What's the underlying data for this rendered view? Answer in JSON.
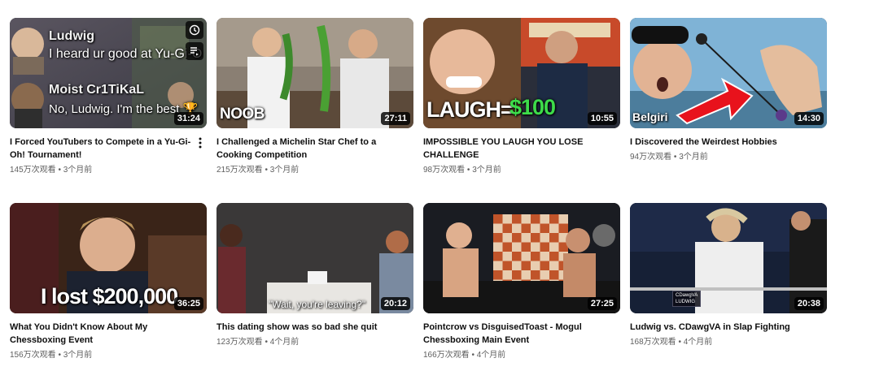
{
  "videos": [
    {
      "title": "I Forced YouTubers to Compete in a Yu-Gi-Oh! Tournament!",
      "views": "145万次观看",
      "age": "3个月前",
      "duration": "31:24",
      "overlay": {
        "name1": "Ludwig",
        "line1": "I heard ur good at Yu-Gi-O",
        "name2": "Moist Cr1TiKaL",
        "line2": "No, Ludwig. I'm the best 🏆"
      },
      "hover_icons": [
        "watch-later-icon",
        "add-to-queue-icon"
      ],
      "show_menu": true
    },
    {
      "title": "I Challenged a Michelin Star Chef to a Cooking Competition",
      "views": "215万次观看",
      "age": "3个月前",
      "duration": "27:11",
      "overlay": {
        "caption": "NOOB"
      }
    },
    {
      "title": "IMPOSSIBLE YOU LAUGH YOU LOSE CHALLENGE",
      "views": "98万次观看",
      "age": "3个月前",
      "duration": "10:55",
      "overlay": {
        "caption_a": "LAUGH=",
        "caption_b": "$100"
      }
    },
    {
      "title": "I Discovered the Weirdest Hobbies",
      "views": "94万次观看",
      "age": "3个月前",
      "duration": "14:30",
      "overlay": {
        "caption": "Belgiri"
      }
    },
    {
      "title": "What You Didn't Know About My Chessboxing Event",
      "views": "156万次观看",
      "age": "3个月前",
      "duration": "36:25",
      "overlay": {
        "caption": "I lost $200,000"
      }
    },
    {
      "title": "This dating show was so bad she quit",
      "views": "123万次观看",
      "age": "4个月前",
      "duration": "20:12",
      "overlay": {
        "caption": "\"Wait, you're leaving?\""
      }
    },
    {
      "title": "Pointcrow vs DisguisedToast - Mogul Chessboxing Main Event",
      "views": "166万次观看",
      "age": "4个月前",
      "duration": "27:25",
      "overlay": {}
    },
    {
      "title": "Ludwig vs. CDawgVA in Slap Fighting",
      "views": "168万次观看",
      "age": "4个月前",
      "duration": "20:38",
      "overlay": {
        "score_a": "CDawgVA",
        "score_b": "LUDWIG"
      }
    }
  ],
  "separator": " • ",
  "colors": {
    "title": "#0f0f0f",
    "meta": "#606060",
    "badge_bg": "#000000",
    "money_green": "#3ddc4a",
    "arrow_red": "#e8121c"
  }
}
